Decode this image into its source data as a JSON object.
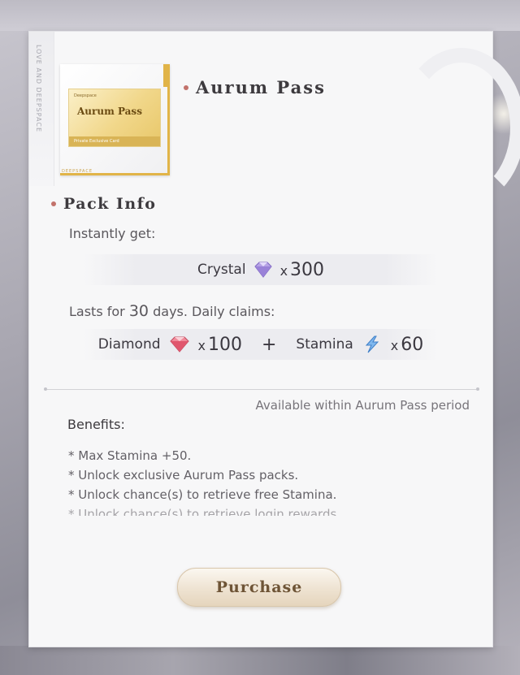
{
  "pass": {
    "title": "Aurum Pass"
  },
  "card": {
    "brand": "Deepspace",
    "title": "Aurum Pass",
    "subtitle": "Private Exclusive Card",
    "footer": "DEEPSPACE",
    "side_text": "LOVE AND DEEPSPACE"
  },
  "pack_info": {
    "heading": "Pack Info",
    "instant_label": "Instantly get:",
    "instant_item": {
      "name": "Crystal",
      "icon": "crystal-icon",
      "x": "x",
      "qty": "300"
    },
    "lasts_prefix": "Lasts for ",
    "lasts_days": "30",
    "lasts_suffix": " days. Daily claims:",
    "daily": [
      {
        "name": "Diamond",
        "icon": "diamond-icon",
        "x": "x",
        "qty": "100"
      },
      {
        "name": "Stamina",
        "icon": "stamina-icon",
        "x": "x",
        "qty": "60"
      }
    ],
    "plus": "+"
  },
  "benefits": {
    "availability": "Available within Aurum Pass period",
    "heading": "Benefits:",
    "items": [
      "* Max Stamina +50.",
      "* Unlock exclusive Aurum Pass packs.",
      "* Unlock chance(s) to retrieve free Stamina.",
      "* Unlock chance(s) to retrieve login rewards."
    ]
  },
  "purchase_label": "Purchase",
  "colors": {
    "accent_dot": "#c2726b",
    "gold": "#e1b448"
  }
}
